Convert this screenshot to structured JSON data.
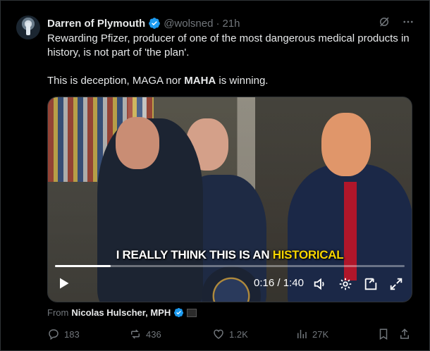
{
  "author": {
    "name": "Darren of Plymouth",
    "handle": "@wolsned",
    "separator": "·",
    "time": "21h",
    "avatar_icon": "ufo-avatar",
    "verified_color": "#1d9bf0"
  },
  "top_actions": [
    "grok-icon",
    "more-icon"
  ],
  "body": {
    "line1": "Rewarding Pfizer, producer of one of the most dangerous medical products in history, is not part of 'the plan'.",
    "line2_pre": "This is deception, MAGA nor ",
    "line2_bold": "MAHA",
    "line2_post": " is winning."
  },
  "video": {
    "caption_pre": "I REALLY THINK THIS IS AN ",
    "caption_highlight": "HISTORICAL",
    "caption_highlight_color": "#f5d400",
    "progress": 0.16,
    "current_time": "0:16",
    "separator": " / ",
    "duration": "1:40",
    "controls": [
      "play-icon",
      "volume-icon",
      "settings-icon",
      "pip-icon",
      "fullscreen-icon"
    ]
  },
  "source": {
    "prefix": "From",
    "name": "Nicolas Hulscher, MPH"
  },
  "engagement": {
    "replies": "183",
    "reposts": "436",
    "likes": "1.2K",
    "views": "27K"
  },
  "colors": {
    "background": "#000000",
    "text": "#e7e9ea",
    "muted": "#71767b",
    "border": "#2f3336"
  }
}
